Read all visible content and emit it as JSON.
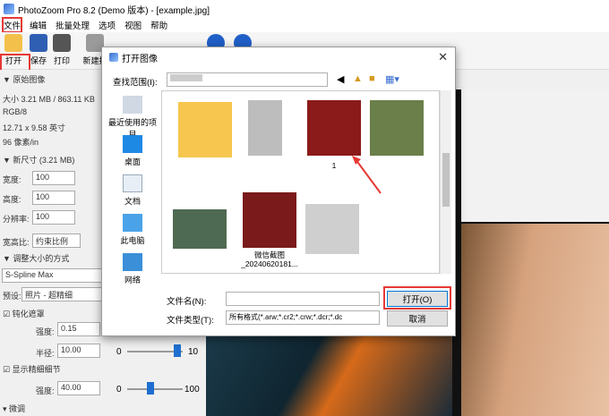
{
  "app": {
    "title": "PhotoZoom Pro 8.2 (Demo 版本) - [example.jpg]"
  },
  "menu": [
    "文件",
    "编辑",
    "批量处理",
    "选项",
    "视图",
    "帮助"
  ],
  "toolbar": {
    "open": "打开",
    "save": "保存",
    "print": "打印",
    "batch": "新建批"
  },
  "left": {
    "section_original": "原始图像",
    "size_line": "大小 3.21 MB / 863.11 KB",
    "mode": "RGB/8",
    "dims": "12.71 x 9.58 英寸",
    "res": "96 像素/in",
    "section_new": "新尺寸 (3.21 MB)",
    "width_label": "宽度:",
    "width_val": "100",
    "height_label": "高度:",
    "height_val": "100",
    "dpi_label": "分辨率:",
    "dpi_val": "100",
    "ratio_label": "宽高比:",
    "ratio_val": "约束比例",
    "section_method": "调整大小的方式",
    "method_val": "S-Spline Max",
    "preset_label": "预设:",
    "preset_val": "照片 - 超精细",
    "unsharp_label": "钝化遮罩",
    "strength_label": "强度:",
    "strength_val": "0.15",
    "radius_label": "半径:",
    "radius_val": "10.00",
    "radius_min": "0",
    "radius_max": "10",
    "detail_label": "显示精细细节",
    "strength2_label": "强度:",
    "strength2_val": "40.00",
    "s2_min": "0",
    "s2_max": "100",
    "micro_label": "微调"
  },
  "dialog": {
    "title": "打开图像",
    "lookin_label": "查找范围(I):",
    "places": [
      {
        "label": "最近使用的项目",
        "icon": "recent-icon"
      },
      {
        "label": "桌面",
        "icon": "desktop-icon"
      },
      {
        "label": "文档",
        "icon": "documents-icon"
      },
      {
        "label": "此电脑",
        "icon": "computer-icon"
      },
      {
        "label": "网络",
        "icon": "network-icon"
      }
    ],
    "files": [
      {
        "caption": ""
      },
      {
        "caption": ""
      },
      {
        "caption": "1"
      },
      {
        "caption": ""
      },
      {
        "caption": ""
      },
      {
        "caption": "微信截图_20240620181..."
      },
      {
        "caption": ""
      }
    ],
    "filename_label": "文件名(N):",
    "filename_val": "",
    "filetype_label": "文件类型(T):",
    "filetype_val": "所有格式(*.arw;*.cr2;*.crw;*.dcr;*.dc",
    "open_btn": "打开(O)",
    "cancel_btn": "取消"
  }
}
